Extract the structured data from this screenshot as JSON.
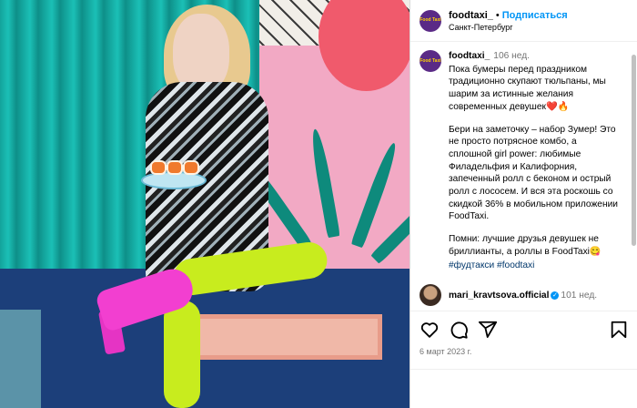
{
  "header": {
    "username": "foodtaxi_",
    "separator": "•",
    "follow_label": "Подписаться",
    "location": "Санкт-Петербург",
    "avatar_text": "Food Taxi"
  },
  "caption": {
    "username": "foodtaxi_",
    "time": "106 нед.",
    "paragraph1": "Пока бумеры перед праздником традиционно скупают тюльпаны, мы шарим за истинные желания современных девушек❤️🔥",
    "paragraph2": "Бери на заметочку – набор Зумер! Это не просто потрясное комбо, а сплошной girl power: любимые Филадельфия и Калифорния, запеченный ролл с беконом и острый ролл с лососем. И вся эта роскошь со скидкой 36% в мобильном приложении FoodTaxi.",
    "paragraph3": "Помни: лучшие друзья девушек не бриллианты, а роллы в FoodTaxi😋",
    "hashtags": "#фудтакси #foodtaxi"
  },
  "comment": {
    "username": "mari_kravtsova.official",
    "verified_mark": "✓",
    "time": "101 нед."
  },
  "actions": {
    "like_icon": "heart-icon",
    "comment_icon": "comment-icon",
    "share_icon": "share-icon",
    "save_icon": "bookmark-icon"
  },
  "date": "6 март 2023 г.",
  "colors": {
    "follow": "#0095f6",
    "hashtag": "#00376b",
    "muted": "#737373",
    "brand_avatar": "#5a2a86"
  }
}
